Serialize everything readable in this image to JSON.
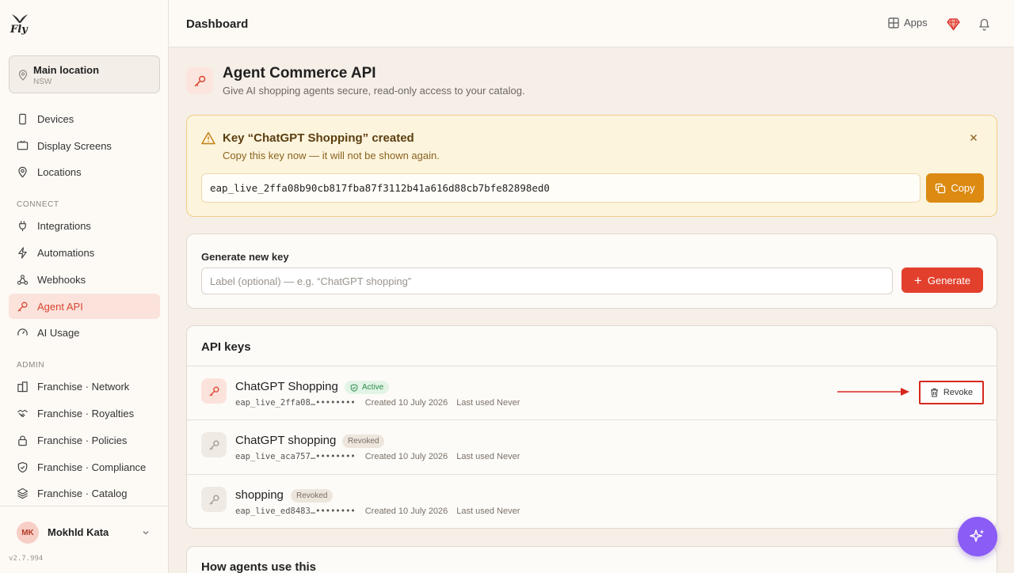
{
  "brand": {
    "logo_text": "Fly"
  },
  "location": {
    "title": "Main location",
    "subtitle": "NSW"
  },
  "sidebar": {
    "main_items": [
      {
        "label": "Devices",
        "icon": "phone-icon"
      },
      {
        "label": "Display Screens",
        "icon": "monitor-icon"
      },
      {
        "label": "Locations",
        "icon": "pin-icon"
      }
    ],
    "connect_label": "CONNECT",
    "connect_items": [
      {
        "label": "Integrations",
        "icon": "plug-icon"
      },
      {
        "label": "Automations",
        "icon": "bolt-icon"
      },
      {
        "label": "Webhooks",
        "icon": "webhook-icon"
      },
      {
        "label": "Agent API",
        "icon": "key-icon",
        "active": true
      },
      {
        "label": "AI Usage",
        "icon": "gauge-icon"
      }
    ],
    "admin_label": "ADMIN",
    "admin_items": [
      {
        "label": "Franchise · Network",
        "icon": "network-icon"
      },
      {
        "label": "Franchise · Royalties",
        "icon": "handshake-icon"
      },
      {
        "label": "Franchise · Policies",
        "icon": "lock-icon"
      },
      {
        "label": "Franchise · Compliance",
        "icon": "shield-icon"
      },
      {
        "label": "Franchise · Catalog",
        "icon": "layers-icon"
      }
    ]
  },
  "user": {
    "initials": "MK",
    "name": "Mokhld Kata"
  },
  "version": "v2.7.994",
  "header": {
    "title": "Dashboard",
    "apps_label": "Apps"
  },
  "page": {
    "title": "Agent Commerce API",
    "subtitle": "Give AI shopping agents secure, read-only access to your catalog."
  },
  "alert": {
    "title": "Key “ChatGPT Shopping” created",
    "subtitle": "Copy this key now — it will not be shown again.",
    "key_value": "eap_live_2ffa08b90cb817fba87f3112b41a616d88cb7bfe82898ed0",
    "copy_label": "Copy"
  },
  "generate": {
    "label": "Generate new key",
    "placeholder": "Label (optional) — e.g. “ChatGPT shopping”",
    "button_label": "Generate"
  },
  "api_keys": {
    "title": "API keys",
    "revoke_label": "Revoke",
    "rows": [
      {
        "name": "ChatGPT Shopping",
        "status": "Active",
        "prefix": "eap_live_2ffa08…••••••••",
        "created": "Created 10 July 2026",
        "last_used": "Last used Never"
      },
      {
        "name": "ChatGPT shopping",
        "status": "Revoked",
        "prefix": "eap_live_aca757…••••••••",
        "created": "Created 10 July 2026",
        "last_used": "Last used Never"
      },
      {
        "name": "shopping",
        "status": "Revoked",
        "prefix": "eap_live_ed8483…••••••••",
        "created": "Created 10 July 2026",
        "last_used": "Last used Never"
      }
    ]
  },
  "how": {
    "title": "How agents use this"
  },
  "colors": {
    "accent": "#e2402c",
    "warning": "#dc8a12",
    "assistant": "#8b5cf6"
  }
}
